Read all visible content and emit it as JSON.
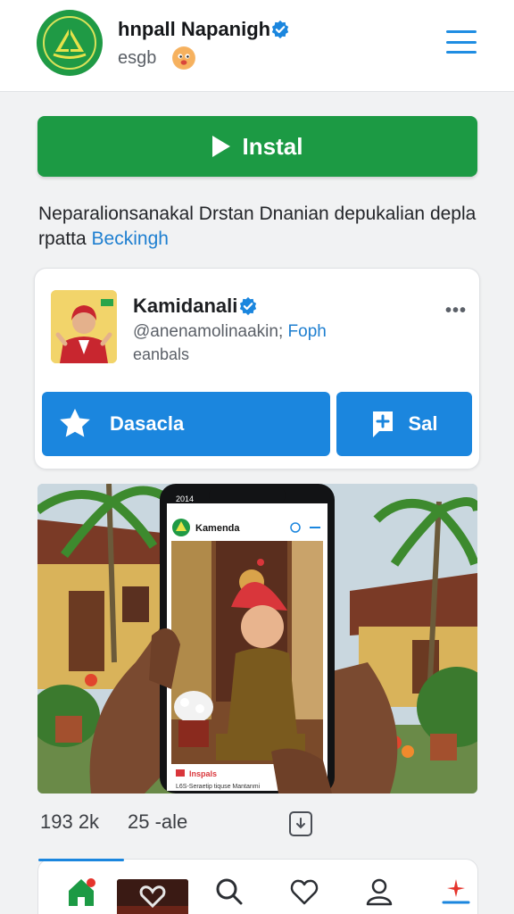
{
  "header": {
    "app_name": "hnpall Napanigh",
    "subtitle": "esgb"
  },
  "install": {
    "label": "Instal"
  },
  "description": {
    "text": "Neparalionsanakal Drstan Dnanian depukalian depla rpatta",
    "link": "Beckingh"
  },
  "profile": {
    "name": "Kamidanali",
    "handle": "@anenamolinaakin;",
    "handle_link": "Foph",
    "meta": "eanbals",
    "favorite_label": "Dasacla",
    "save_label": "Sal"
  },
  "hero": {
    "phone_time": "2014",
    "phone_app_name": "Kamenda",
    "phone_caption_title": "Inspals",
    "phone_caption_text": "L6S-Seraetip tiquse Mantanmi"
  },
  "stats": {
    "likes": "193 2k",
    "shares": "25 -ale"
  },
  "colors": {
    "brand_green": "#1c9a44",
    "accent_blue": "#1b86de",
    "link_blue": "#1e7fd0"
  },
  "icons": [
    "menu-icon",
    "verified-icon",
    "emoji-icon",
    "play-icon",
    "more-icon",
    "star-icon",
    "add-icon",
    "share-icon",
    "home-icon",
    "search-icon",
    "heart-icon",
    "profile-icon",
    "sparkle-icon"
  ]
}
